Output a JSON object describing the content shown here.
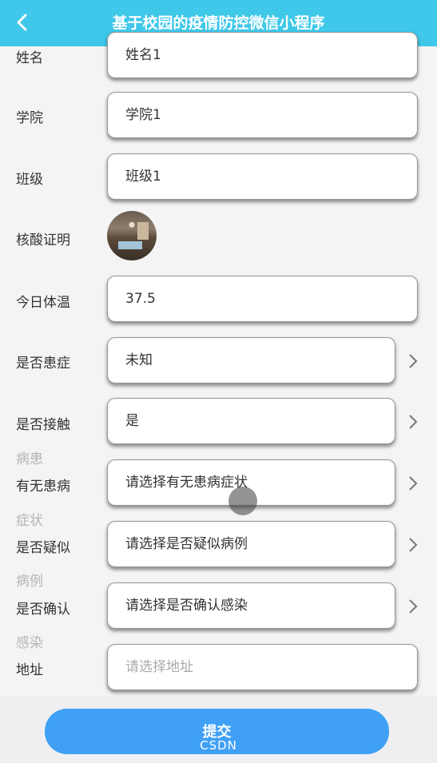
{
  "header": {
    "title": "基于校园的疫情防控微信小程序"
  },
  "form": {
    "name": {
      "label": "姓名",
      "value": "姓名1"
    },
    "college": {
      "label": "学院",
      "value": "学院1"
    },
    "class": {
      "label": "班级",
      "value": "班级1"
    },
    "nucleic": {
      "label": "核酸证明"
    },
    "temperature": {
      "label": "今日体温",
      "value": "37.5"
    },
    "ill": {
      "label": "是否患症",
      "value": "未知"
    },
    "contact": {
      "label": "是否接触",
      "value": "是"
    },
    "symptom": {
      "label_line1": "病患",
      "label_line2": "有无患病",
      "placeholder": "请选择有无患病症状"
    },
    "suspected": {
      "label_line1": "症状",
      "label_line2": "是否疑似",
      "placeholder": "请选择是否疑似病例"
    },
    "confirmed": {
      "label_line1": "病例",
      "label_line2": "是否确认",
      "placeholder": "请选择是否确认感染"
    },
    "address": {
      "label_line1": "感染",
      "label_line2": "地址",
      "placeholder": "请选择地址"
    }
  },
  "submit_label": "提交",
  "watermark": "CSDN",
  "icons": {
    "back": "chevron-left-icon",
    "select": "chevron-right-icon"
  },
  "colors": {
    "header": "#3fc8ea",
    "submit": "#3fa0f5"
  }
}
